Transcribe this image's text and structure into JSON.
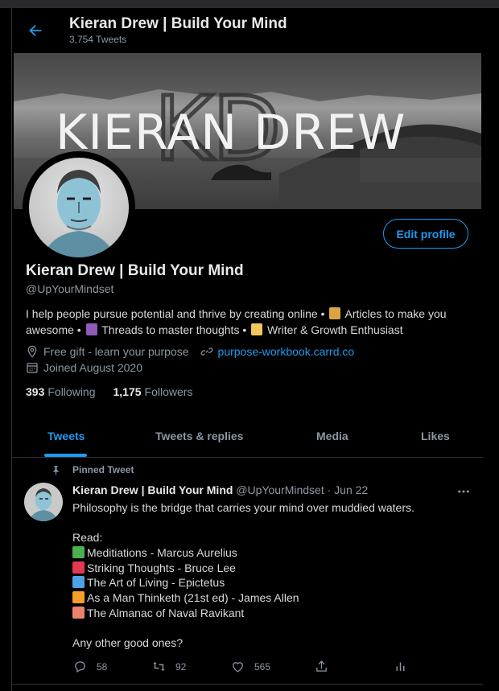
{
  "header": {
    "title": "Kieran Drew | Build Your Mind",
    "tweet_count": "3,754 Tweets"
  },
  "banner": {
    "text": "KIERAN DREW",
    "watermark": "KD"
  },
  "profile": {
    "edit_button": "Edit profile",
    "name": "Kieran Drew | Build Your Mind",
    "handle": "@UpYourMindset",
    "bio": {
      "part1": "I help people pursue potential and thrive by creating online • ",
      "part2": " Articles to make you awesome • ",
      "part3": " Threads to master thoughts • ",
      "part4": " Writer & Growth Enthusiast"
    },
    "location": "Free gift - learn your purpose",
    "link": "purpose-workbook.carrd.co",
    "joined": "Joined August 2020",
    "following_count": "393",
    "following_label": "Following",
    "followers_count": "1,175",
    "followers_label": "Followers"
  },
  "tabs": [
    {
      "label": "Tweets",
      "active": true
    },
    {
      "label": "Tweets & replies",
      "active": false
    },
    {
      "label": "Media",
      "active": false
    },
    {
      "label": "Likes",
      "active": false
    }
  ],
  "tweet": {
    "pinned_label": "Pinned Tweet",
    "author_name": "Kieran Drew | Build Your Mind",
    "author_meta": "@UpYourMindset · Jun 22",
    "line1": "Philosophy is the bridge that carries your mind over muddied waters.",
    "read_label": "Read:",
    "books": [
      {
        "title": "Meditiations - Marcus Aurelius",
        "color": "#4caf50"
      },
      {
        "title": "Striking Thoughts - Bruce Lee",
        "color": "#e53950"
      },
      {
        "title": "The Art of Living - Epictetus",
        "color": "#4da3e6"
      },
      {
        "title": "As a Man Thinketh (21st ed) - James Allen",
        "color": "#f59e2a"
      },
      {
        "title": "The Almanac of Naval Ravikant",
        "color": "#e8836b"
      }
    ],
    "closing": "Any other good ones?",
    "replies": "58",
    "retweets": "92",
    "likes": "565"
  },
  "colors": {
    "accent": "#1d9bf0",
    "background": "#000000",
    "muted": "#8b98a5"
  }
}
